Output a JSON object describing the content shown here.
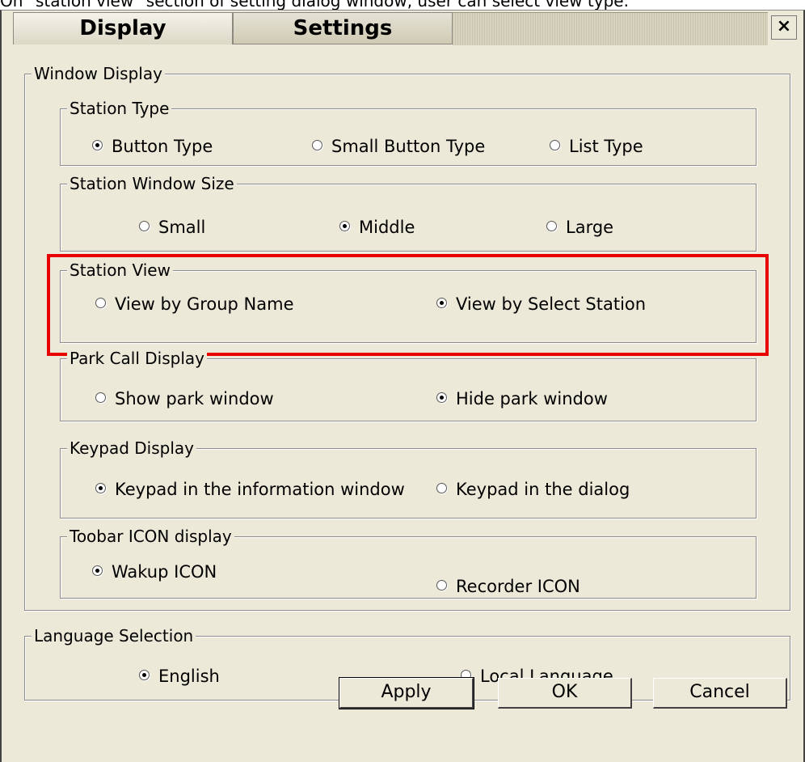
{
  "caption": "On \"station view\" section of setting dialog window, user can select view type.",
  "tabs": {
    "display": "Display",
    "settings": "Settings",
    "close": "×"
  },
  "window_display": {
    "title": "Window Display",
    "station_type": {
      "title": "Station Type",
      "options": [
        "Button Type",
        "Small Button Type",
        "List Type"
      ],
      "selected": "Button Type"
    },
    "station_window_size": {
      "title": "Station Window Size",
      "options": [
        "Small",
        "Middle",
        "Large"
      ],
      "selected": "Middle"
    },
    "station_view": {
      "title": "Station View",
      "options": [
        "View by Group Name",
        "View by Select Station"
      ],
      "selected": "View by Select Station"
    },
    "park_call_display": {
      "title": "Park Call Display",
      "options": [
        "Show park window",
        "Hide park window"
      ],
      "selected": "Hide park window"
    },
    "keypad_display": {
      "title": "Keypad Display",
      "options": [
        "Keypad in the information window",
        "Keypad in the dialog"
      ],
      "selected": "Keypad in the information window"
    },
    "toolbar_icon_display": {
      "title": "Toobar ICON display",
      "options": [
        "Wakup ICON",
        "Recorder ICON"
      ],
      "selected": "Wakup ICON"
    }
  },
  "language_selection": {
    "title": "Language Selection",
    "options": [
      "English",
      "Local Language"
    ],
    "selected": "English"
  },
  "buttons": {
    "apply": "Apply",
    "ok": "OK",
    "cancel": "Cancel"
  },
  "colors": {
    "dialog_bg": "#ece9d8",
    "highlight": "#e80000"
  }
}
